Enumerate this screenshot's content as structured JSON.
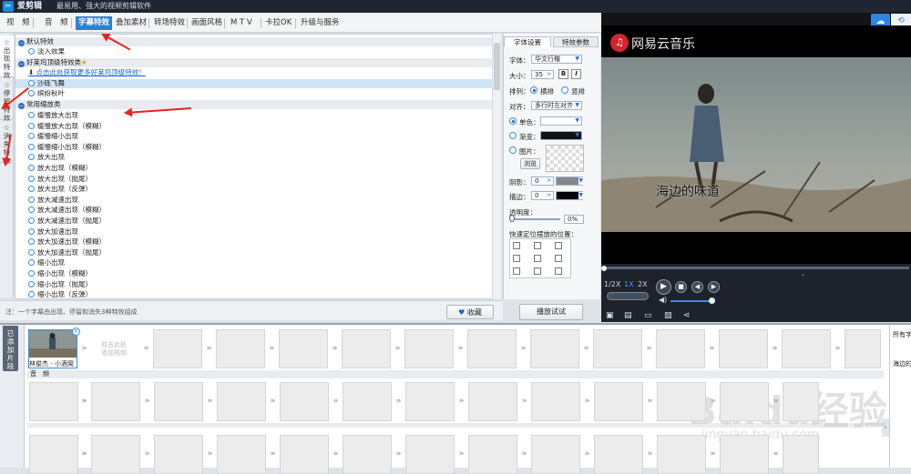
{
  "app": {
    "name": "爱剪辑",
    "slogan": "最易用、强大的视频剪辑软件"
  },
  "menu": {
    "tabs": [
      "视　频",
      "音　频",
      "字幕特效",
      "叠加素材",
      "转场特效",
      "画面风格",
      "M T V",
      "卡拉OK",
      "升级与服务"
    ],
    "active": "字幕特效"
  },
  "side_tabs": [
    {
      "label": "出现特效"
    },
    {
      "label": "停留特效"
    },
    {
      "label": "消失特效"
    }
  ],
  "effects": {
    "groups": [
      {
        "title": "默认特效"
      },
      {
        "title": "好莱坞顶级特效类",
        "link": "点击此处获取更多好莱坞顶级特效！"
      },
      {
        "title": "常用缩放类"
      }
    ],
    "default_items": [
      "淡入效果"
    ],
    "hollywood_items": [
      "沙砾飞舞",
      "缤纷秋叶"
    ],
    "zoom_items": [
      "缓慢放大出现",
      "缓慢放大出现（模糊）",
      "缓慢缩小出现",
      "缓慢缩小出现（模糊）",
      "放大出现",
      "放大出现（模糊）",
      "放大出现（抛尾）",
      "放大出现（反弹）",
      "放大减速出现",
      "放大减速出现（模糊）",
      "放大减速出现（抛尾）",
      "放大加速出现",
      "放大加速出现（模糊）",
      "放大加速出现（抛尾）",
      "缩小出现",
      "缩小出现（模糊）",
      "缩小出现（抛尾）",
      "缩小出现（反弹）"
    ]
  },
  "note": "注：一个字幕由出现、停留和消失3种特效组成",
  "buttons": {
    "favorite": "收藏",
    "play_test": "播放试试",
    "browse": "浏览"
  },
  "font_panel": {
    "tabs": [
      "字体设置",
      "特效参数"
    ],
    "font_label": "字体：",
    "font_value": "华文行楷",
    "size_label": "大小：",
    "size_value": "35",
    "bold": "B",
    "italic": "I",
    "layout_label": "排列：",
    "layout_options": [
      "横排",
      "竖排"
    ],
    "align_label": "对齐：",
    "align_value": "多行时左对齐",
    "solid_label": "单色：",
    "gradient_label": "渐变：",
    "image_label": "图片：",
    "shadow_label": "阴影：",
    "shadow_value": "0",
    "stroke_label": "描边：",
    "stroke_value": "0",
    "opacity_label": "透明度：",
    "opacity_value": "0%",
    "position_label": "快速定位摆放的位置："
  },
  "player": {
    "logo_text": "网易云音乐",
    "subtitle": "海边的味道",
    "speeds": [
      "1/2X",
      "1X",
      "2X"
    ]
  },
  "timeline": {
    "tab": "已添加片段",
    "clip": {
      "name": "林俊杰 - 小酒窝"
    },
    "add_hint": "双击此处\n添加视频",
    "audio_label": "音　频",
    "right_panel": {
      "header": "所有字",
      "item": "海边的"
    }
  },
  "watermark": {
    "main": "Baidu经验",
    "sub": "jingyan.baidu.com"
  },
  "colors": {
    "accent": "#2d7fd6",
    "annotation": "#e8231d"
  }
}
